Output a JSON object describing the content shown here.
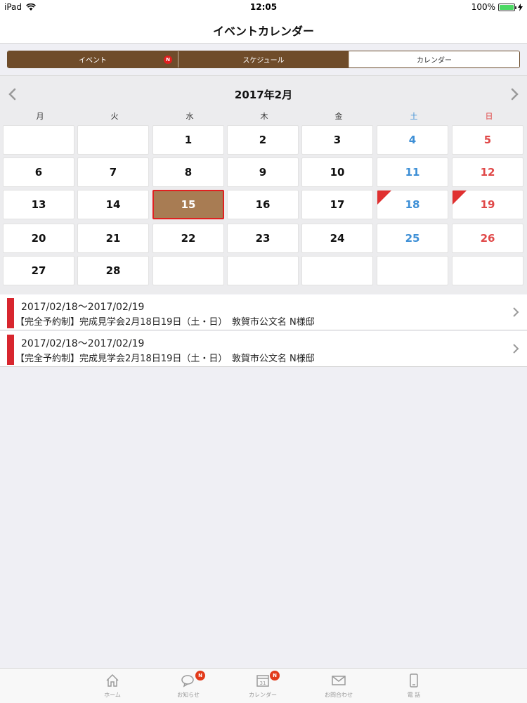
{
  "status_bar": {
    "device": "iPad",
    "time": "12:05",
    "battery": "100%",
    "battery_level": 1.0
  },
  "nav": {
    "title": "イベントカレンダー"
  },
  "segments": [
    {
      "label": "イベント",
      "badge": "N"
    },
    {
      "label": "スケジュール"
    },
    {
      "label": "カレンダー"
    }
  ],
  "calendar": {
    "month_title": "2017年2月",
    "weekdays": [
      "月",
      "火",
      "水",
      "木",
      "金",
      "土",
      "日"
    ],
    "rows": [
      [
        "",
        "",
        "1",
        "2",
        "3",
        "4",
        "5"
      ],
      [
        "6",
        "7",
        "8",
        "9",
        "10",
        "11",
        "12"
      ],
      [
        "13",
        "14",
        "15",
        "16",
        "17",
        "18",
        "19"
      ],
      [
        "20",
        "21",
        "22",
        "23",
        "24",
        "25",
        "26"
      ],
      [
        "27",
        "28",
        "",
        "",
        "",
        "",
        ""
      ]
    ],
    "today": "15",
    "event_days": [
      "18",
      "19"
    ],
    "colors": {
      "saturday": "#3d8fd6",
      "sunday": "#e04848",
      "today_bg": "#a87c53",
      "event_marker": "#e03030"
    }
  },
  "events": [
    {
      "date": "2017/02/18〜2017/02/19",
      "title": "【完全予約制】完成見学会2月18日19日（土・日）　敦賀市公文名 N様邸"
    },
    {
      "date": "2017/02/18〜2017/02/19",
      "title": "【完全予約制】完成見学会2月18日19日（土・日）　敦賀市公文名 N様邸"
    }
  ],
  "tabs": [
    {
      "label": "ホーム",
      "icon": "home-icon"
    },
    {
      "label": "お知らせ",
      "icon": "chat-bubble-icon",
      "badge": "N"
    },
    {
      "label": "カレンダー",
      "icon": "calendar-icon",
      "badge": "N",
      "icon_text": "31"
    },
    {
      "label": "お問合わせ",
      "icon": "mail-icon"
    },
    {
      "label": "電 話",
      "icon": "phone-icon"
    }
  ]
}
